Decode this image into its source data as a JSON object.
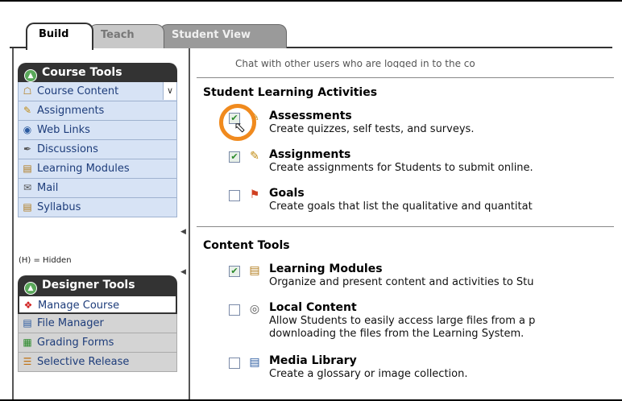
{
  "tabs": [
    {
      "label": "Build",
      "active": true
    },
    {
      "label": "Teach",
      "active": false
    },
    {
      "label": "Student View",
      "active": false
    }
  ],
  "course_tools": {
    "header": "Course Tools",
    "items": [
      {
        "label": "Course Content",
        "icon": "course-content-icon"
      },
      {
        "label": "Assignments",
        "icon": "assignments-icon"
      },
      {
        "label": "Web Links",
        "icon": "web-links-icon"
      },
      {
        "label": "Discussions",
        "icon": "discussions-icon"
      },
      {
        "label": "Learning Modules",
        "icon": "learning-modules-icon"
      },
      {
        "label": "Mail",
        "icon": "mail-icon"
      },
      {
        "label": "Syllabus",
        "icon": "syllabus-icon"
      }
    ],
    "hidden_note": "(H) = Hidden"
  },
  "designer_tools": {
    "header": "Designer Tools",
    "items": [
      {
        "label": "Manage Course",
        "icon": "manage-course-icon"
      },
      {
        "label": "File Manager",
        "icon": "file-manager-icon"
      },
      {
        "label": "Grading Forms",
        "icon": "grading-forms-icon"
      },
      {
        "label": "Selective Release",
        "icon": "selective-release-icon"
      }
    ]
  },
  "content": {
    "cutoff_text": "Chat with other users who are logged in to the co",
    "student_learning": {
      "title": "Student Learning Activities",
      "items": [
        {
          "title": "Assessments",
          "desc": "Create quizzes, self tests, and surveys.",
          "checked": true
        },
        {
          "title": "Assignments",
          "desc": "Create assignments for Students to submit online.",
          "checked": true
        },
        {
          "title": "Goals",
          "desc": "Create goals that list the qualitative and quantitat",
          "checked": false
        }
      ]
    },
    "content_tools": {
      "title": "Content Tools",
      "items": [
        {
          "title": "Learning Modules",
          "desc": "Organize and present content and activities to Stu",
          "checked": true
        },
        {
          "title": "Local Content",
          "desc": "Allow Students to easily access large files from a p",
          "desc2": "downloading the files from the Learning System.",
          "checked": false
        },
        {
          "title": "Media Library",
          "desc": "Create a glossary or image collection.",
          "checked": false
        }
      ]
    }
  },
  "colors": {
    "highlight": "#f08a1e",
    "nav_bg": "#d7e3f5",
    "nav_text": "#1d3c7a"
  }
}
